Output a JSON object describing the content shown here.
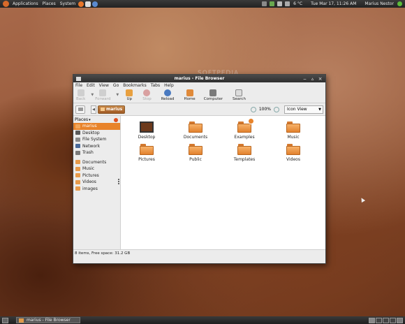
{
  "top_panel": {
    "applications": "Applications",
    "places": "Places",
    "system": "System",
    "temperature": "6 °C",
    "datetime": "Tue Mar 17, 11:26 AM",
    "user": "Marius Nestor"
  },
  "watermark": "SOFTPEDIA",
  "window": {
    "title": "marius - File Browser",
    "menu": [
      "File",
      "Edit",
      "View",
      "Go",
      "Bookmarks",
      "Tabs",
      "Help"
    ],
    "toolbar": {
      "back": "Back",
      "forward": "Forward",
      "up": "Up",
      "stop": "Stop",
      "reload": "Reload",
      "home": "Home",
      "computer": "Computer",
      "search": "Search"
    },
    "location": {
      "crumb": "marius",
      "zoom": "100%",
      "view": "Icon View"
    },
    "sidebar": {
      "header": "Places",
      "items": [
        {
          "label": "marius",
          "selected": true,
          "color": "#f2a65a"
        },
        {
          "label": "Desktop",
          "color": "#5a5a5a"
        },
        {
          "label": "File System",
          "color": "#8a8a8a"
        },
        {
          "label": "Network",
          "color": "#4a6a9a"
        },
        {
          "label": "Trash",
          "color": "#7a7a7a"
        }
      ],
      "bookmarks": [
        {
          "label": "Documents"
        },
        {
          "label": "Music"
        },
        {
          "label": "Pictures"
        },
        {
          "label": "Videos"
        },
        {
          "label": "images"
        }
      ]
    },
    "files": [
      {
        "label": "Desktop"
      },
      {
        "label": "Documents"
      },
      {
        "label": "Examples"
      },
      {
        "label": "Music"
      },
      {
        "label": "Pictures"
      },
      {
        "label": "Public"
      },
      {
        "label": "Templates"
      },
      {
        "label": "Videos"
      }
    ],
    "status": "8 items, Free space: 31.2 GB"
  },
  "taskbar": {
    "window_button": "marius - File Browser"
  },
  "colors": {
    "accent": "#e8832a",
    "folder": "#f0a050"
  }
}
